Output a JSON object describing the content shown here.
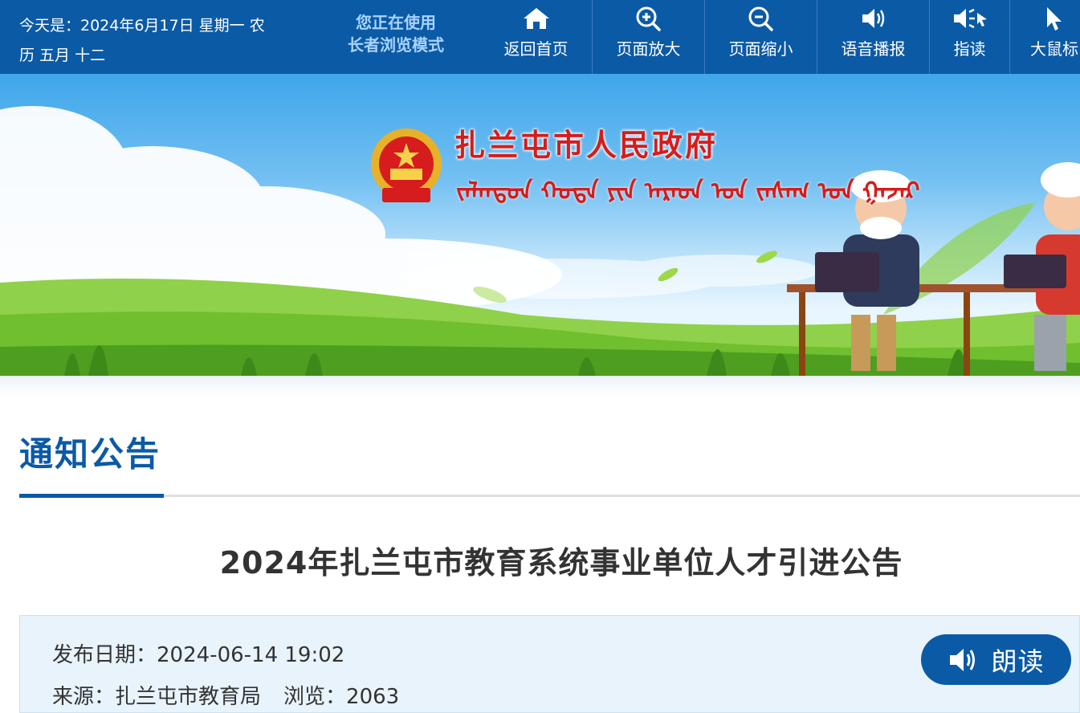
{
  "topbar": {
    "date_line1": "今天是：2024年6月17日 星期一 农",
    "date_line2": "历 五月 十二",
    "mode_line1": "您正在使用",
    "mode_line2": "长者浏览模式",
    "tools": [
      {
        "label": "返回首页",
        "icon": "home-icon"
      },
      {
        "label": "页面放大",
        "icon": "zoom-in-icon"
      },
      {
        "label": "页面缩小",
        "icon": "zoom-out-icon"
      },
      {
        "label": "语音播报",
        "icon": "speaker-icon"
      },
      {
        "label": "指读",
        "icon": "point-read-icon"
      },
      {
        "label": "大鼠标",
        "icon": "cursor-icon"
      }
    ]
  },
  "banner": {
    "title": "扎兰屯市人民政府",
    "subtitle_mongolian": "ᠵᠠᠯᠠᠨᠲᠤᠨ ᠬᠣᠲᠠ ᠶᠢᠨ ᠠᠷᠠᠳ ᠤᠨ ᠵᠠᠰᠠᠭ ᠤᠨ ᠭᠠᠵᠠᠷ",
    "emblem": "national-emblem"
  },
  "section": {
    "title": "通知公告"
  },
  "article": {
    "title": "2024年扎兰屯市教育系统事业单位人才引进公告",
    "publish_label": "发布日期：",
    "publish_date": "2024-06-14 19:02",
    "source_label": "来源：",
    "source": "扎兰屯市教育局",
    "views_label": "浏览：",
    "views": "2063",
    "read_button": "朗读"
  },
  "colors": {
    "primary": "#0b5aa6",
    "title_red": "#d61c1c",
    "meta_bg": "#e8f3fc"
  }
}
